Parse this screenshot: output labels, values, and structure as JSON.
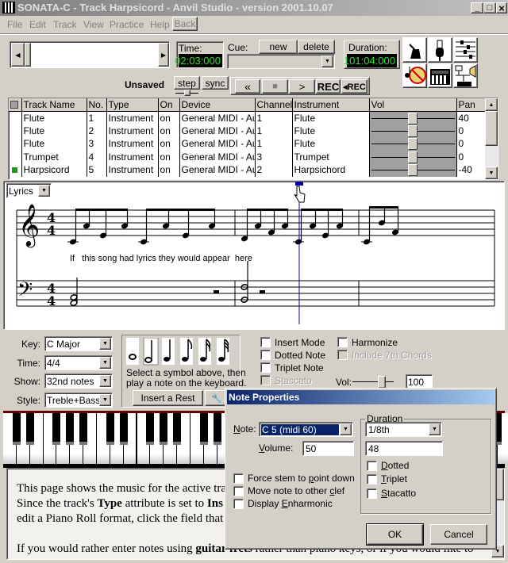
{
  "window": {
    "title": "SONATA-C - Track Harpsicord - Anvil Studio - version 2001.10.07",
    "minimize": "_",
    "maximize": "□",
    "close": "×"
  },
  "menu": [
    "File",
    "Edit",
    "Track",
    "View",
    "Practice",
    "Help"
  ],
  "menu_back": "Back",
  "toolbar": {
    "time_label": "Time:",
    "time_value": "02:03:000",
    "cue_label": "Cue:",
    "cue_new": "new",
    "cue_delete": "delete",
    "duration_label": "Duration:",
    "duration_value": "101:04:000",
    "unsaved": "Unsaved",
    "step": "step",
    "sync": "sync",
    "rewind": "«",
    "stop": "■",
    "play": ">",
    "rec": "REC",
    "rec_back": "◂REC"
  },
  "tools": [
    "metronome-icon",
    "microphone-icon",
    "mixer-icon",
    "mute-instrument-icon",
    "keyboard-icon",
    "audio-routing-icon"
  ],
  "tracks": {
    "headers": [
      "Track Name",
      "No.",
      "Type",
      "On",
      "Device",
      "Channel",
      "Instrument",
      "Vol",
      "Pan"
    ],
    "rows": [
      {
        "name": "Flute",
        "no": "1",
        "type": "Instrument",
        "on": "on",
        "device": "General MIDI - Aur",
        "channel": "1",
        "instrument": "Flute",
        "vol": 0.5,
        "pan": "40",
        "active": false
      },
      {
        "name": "Flute",
        "no": "2",
        "type": "Instrument",
        "on": "on",
        "device": "General MIDI - Aur",
        "channel": "1",
        "instrument": "Flute",
        "vol": 0.5,
        "pan": "0",
        "active": false
      },
      {
        "name": "Flute",
        "no": "3",
        "type": "Instrument",
        "on": "on",
        "device": "General MIDI - Aur",
        "channel": "1",
        "instrument": "Flute",
        "vol": 0.5,
        "pan": "0",
        "active": false
      },
      {
        "name": "Trumpet",
        "no": "4",
        "type": "Instrument",
        "on": "on",
        "device": "General MIDI - Aur",
        "channel": "3",
        "instrument": "Trumpet",
        "vol": 0.5,
        "pan": "0",
        "active": false
      },
      {
        "name": "Harpsicord",
        "no": "5",
        "type": "Instrument",
        "on": "on",
        "device": "General MIDI - Aur",
        "channel": "2",
        "instrument": "Harpsichord",
        "vol": 0.5,
        "pan": "-40",
        "active": true
      }
    ]
  },
  "score": {
    "view_select": "Lyrics",
    "time_sig": "4",
    "lyrics": "If   this song had lyrics they would appear  here"
  },
  "panel": {
    "key_label": "Key:",
    "key": "C Major",
    "time_label": "Time:",
    "time": "4/4",
    "show_label": "Show:",
    "show": "32nd notes",
    "style_label": "Style:",
    "style": "Treble+Bass",
    "hint1": "Select a symbol above, then",
    "hint2": "play a note on the keyboard.",
    "insert_rest": "Insert a Rest",
    "insert_mode": "Insert Mode",
    "dotted_note": "Dotted Note",
    "triplet_note": "Triplet Note",
    "staccato": "Staccato",
    "harmonize": "Harmonize",
    "include7": "Include 7th Chords",
    "vol_label": "Vol:",
    "vol": "100"
  },
  "help": {
    "l1": "This page shows the music for the active tra",
    "l2a": "Since the track's ",
    "l2b": "Type",
    "l2c": " attribute is set to ",
    "l2d": "Ins",
    "l3": "edit a Piano Roll format, click the field that :",
    "l4a": "If you would rather enter notes using ",
    "l4b": "guitar frets",
    "l4c": " rather than piano keys, or if you would like to"
  },
  "dialog": {
    "title": "Note Properties",
    "note_label": "Note:",
    "note": "C 5 (midi 60)",
    "volume_label": "Volume:",
    "volume": "50",
    "duration_group": "Duration",
    "duration": "1/8th",
    "ticks": "48",
    "dotted": "Dotted",
    "triplet": "Triplet",
    "stacatto": "Stacatto",
    "force_stem": "Force stem to point down",
    "move_clef": "Move note to other clef",
    "enharmonic": "Display Enharmonic",
    "ok": "OK",
    "cancel": "Cancel"
  },
  "colors": {
    "lcd_text": "#2ee02e",
    "title_active": "#0a246a",
    "selection": "#0a246a",
    "cursor": "#0000a0"
  }
}
